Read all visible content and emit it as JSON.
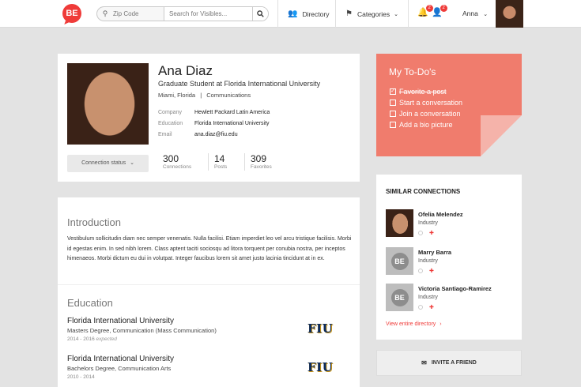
{
  "nav": {
    "logo": "BE",
    "zip_placeholder": "Zip Code",
    "search_placeholder": "Search for Visibles...",
    "directory": "Directory",
    "categories": "Categories",
    "notif_count": "2",
    "people_count": "2",
    "user": "Anna"
  },
  "profile": {
    "name": "Ana Diaz",
    "title": "Graduate Student at Florida International University",
    "location": "Miami, Florida",
    "field": "Communications",
    "company_label": "Company",
    "company": "Hewlett Packard Latin America",
    "education_label": "Education",
    "education": "Florida International University",
    "email_label": "Email",
    "email": "ana.diaz@fiu.edu",
    "connection_status": "Connection status",
    "stats": [
      {
        "num": "300",
        "label": "Connections"
      },
      {
        "num": "14",
        "label": "Posts"
      },
      {
        "num": "309",
        "label": "Favorites"
      }
    ]
  },
  "todo": {
    "title": "My To-Do's",
    "items": [
      {
        "label": "Favorite a post",
        "done": true
      },
      {
        "label": "Start a conversation",
        "done": false
      },
      {
        "label": "Join a conversation",
        "done": false
      },
      {
        "label": "Add a bio picture",
        "done": false
      }
    ]
  },
  "intro": {
    "heading": "Introduction",
    "text": "Vestibulum sollicitudin diam nec semper venenatis. Nulla facilisi. Etiam imperdiet leo vel arcu tristique facilisis. Morbi id egestas enim. In sed nibh lorem. Class aptent taciti sociosqu ad litora torquent per conubia nostra, per inceptos himenaeos. Morbi dictum eu dui in volutpat. Integer faucibus lorem sit amet justo lacinia tincidunt at in ex."
  },
  "education": {
    "heading": "Education",
    "entries": [
      {
        "school": "Florida International University",
        "degree": "Masters Degree, Communication (Mass Communication)",
        "years": "2014 - 2016",
        "note": "expected",
        "logo": "FIU"
      },
      {
        "school": "Florida International University",
        "degree": "Bachelors Degree, Communication Arts",
        "years": "2010 - 2014",
        "note": "",
        "logo": "FIU"
      }
    ]
  },
  "similar": {
    "heading": "SIMILAR CONNECTIONS",
    "people": [
      {
        "name": "Ofelia Melendez",
        "info": "Industry",
        "avatar": "photo"
      },
      {
        "name": "Marry Barra",
        "info": "Industry",
        "avatar": "BE"
      },
      {
        "name": "Victoria Santiago-Ramirez",
        "info": "Industry",
        "avatar": "BE"
      }
    ],
    "view_all": "View entire directory"
  },
  "invite": {
    "label": "INVITE A FRIEND"
  }
}
